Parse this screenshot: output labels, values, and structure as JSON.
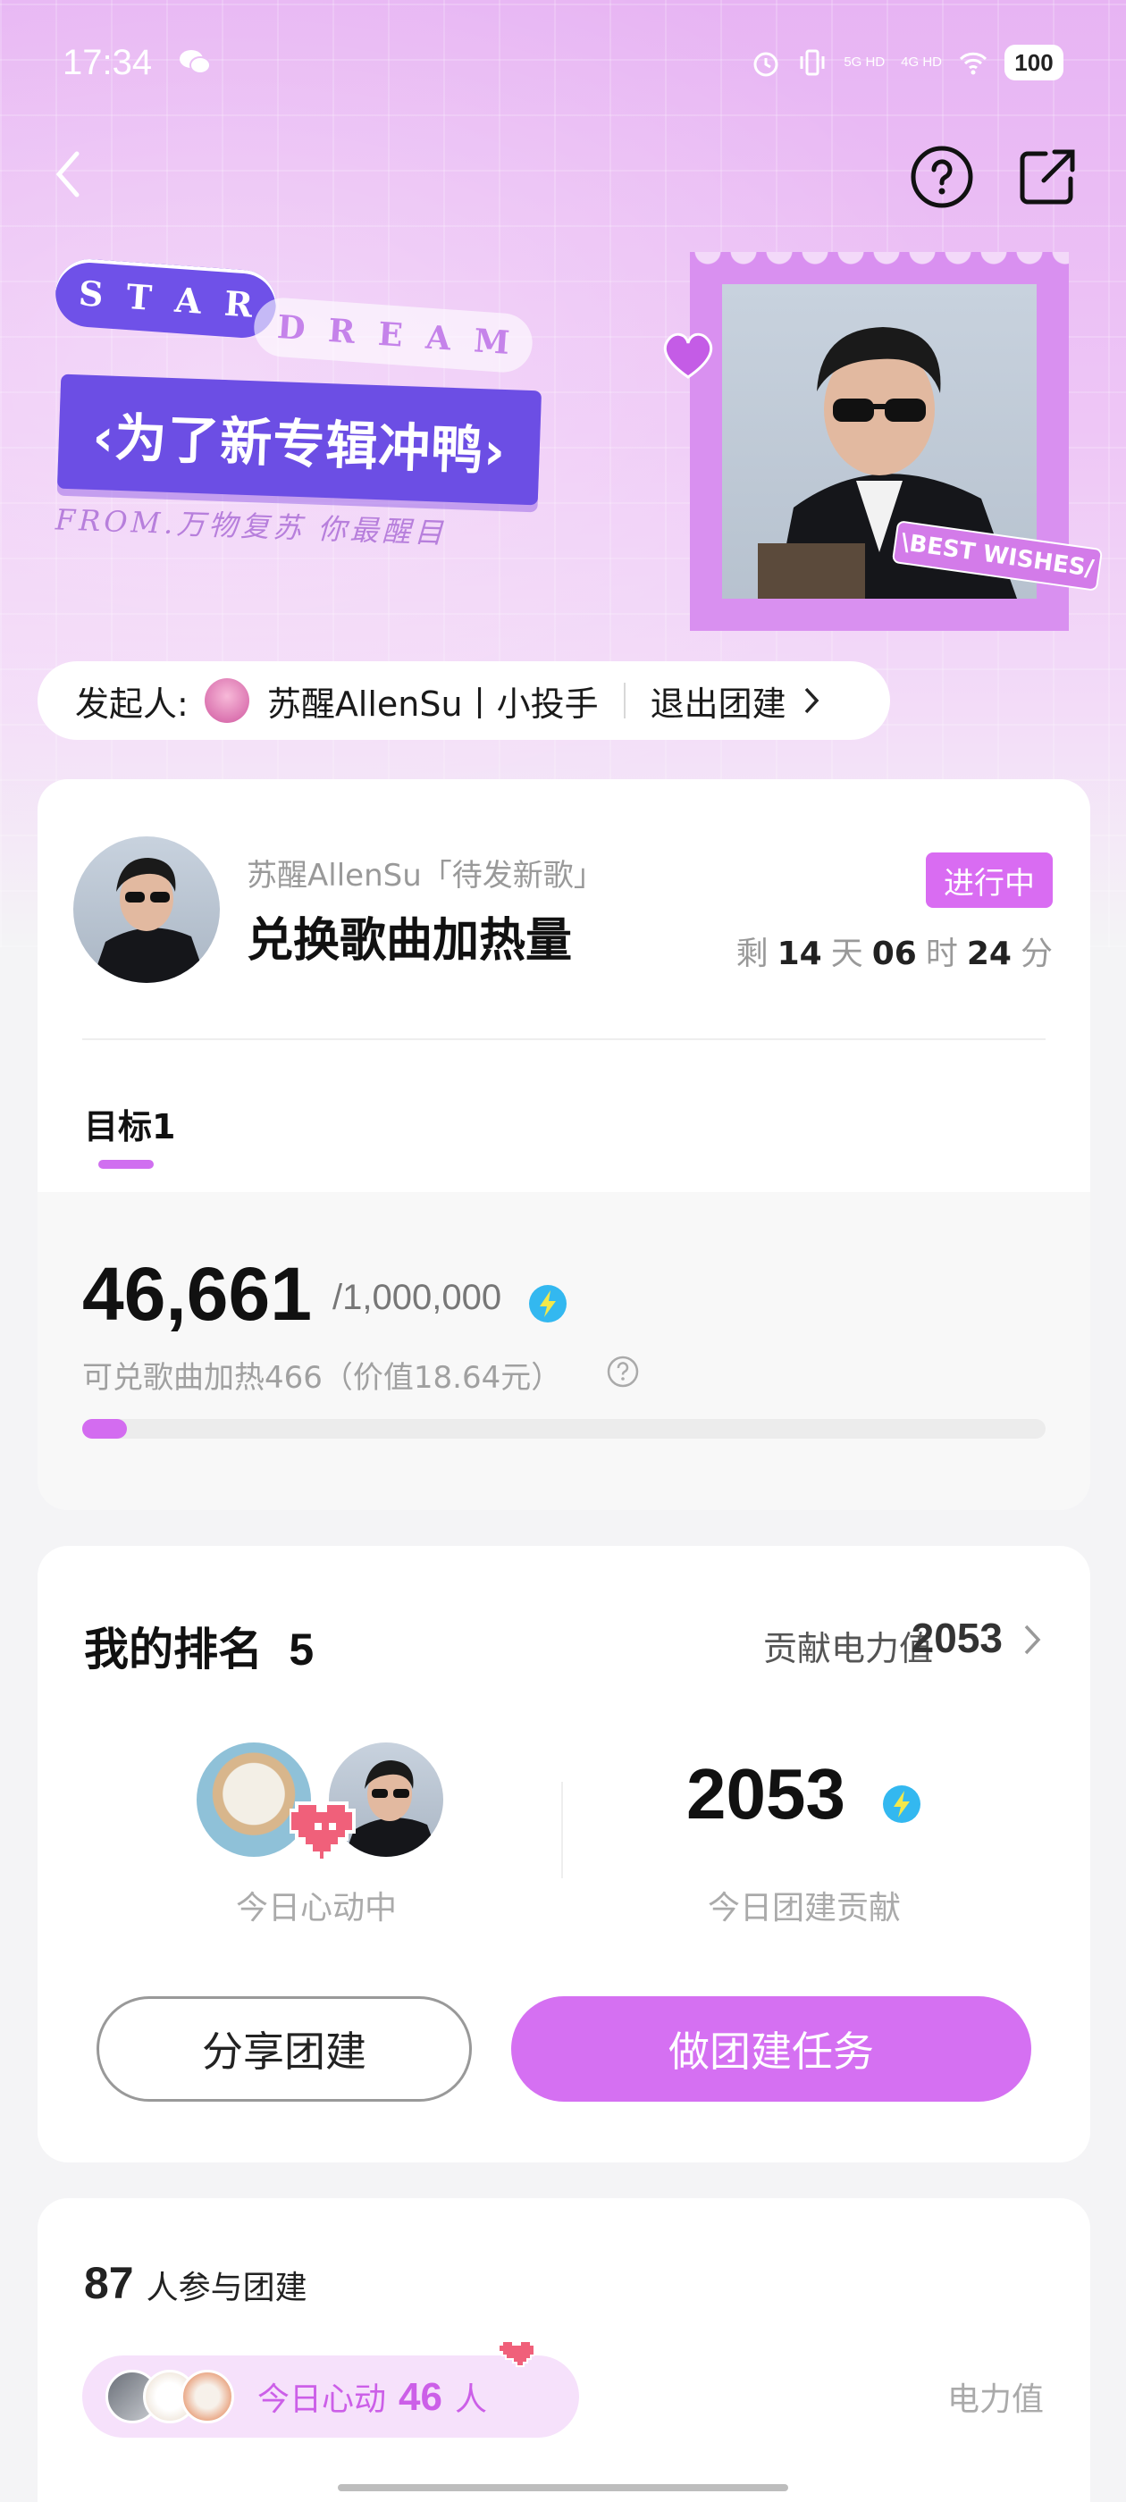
{
  "status_bar": {
    "time": "17:34",
    "net1": "5G HD",
    "net2": "4G HD",
    "battery": "100"
  },
  "banner": {
    "star_letters": [
      "S",
      "T",
      "A",
      "R"
    ],
    "dream_letters": [
      "D",
      "R",
      "E",
      "A",
      "M"
    ],
    "title": "‹为了新专辑冲鸭›",
    "from": "FROM.万物复苏 你最醒目",
    "best_wishes": "\\BEST WISHES/"
  },
  "initiator": {
    "label": "发起人:",
    "name": "苏醒AllenSu丨小投手",
    "exit_label": "退出团建"
  },
  "campaign": {
    "artist_line": "苏醒AllenSu「待发新歌」",
    "title": "兑换歌曲加热量",
    "status": "进行中",
    "countdown": {
      "prefix": "剩",
      "days": "14",
      "days_unit": "天",
      "hours": "06",
      "hours_unit": "时",
      "minutes": "24",
      "minutes_unit": "分"
    },
    "target_tab": "目标1",
    "progress_value": "46,661",
    "progress_goal": "/1,000,000",
    "progress_fraction": 0.046661,
    "description": "可兑歌曲加热466（价值18.64元）"
  },
  "ranking": {
    "title": "我的排名",
    "rank": "5",
    "contrib_label": "贡献电力值",
    "contrib_value": "2053",
    "heart_label": "今日心动中",
    "today_value": "2053",
    "today_label": "今日团建贡献",
    "share_button": "分享团建",
    "task_button": "做团建任务"
  },
  "participants": {
    "count": "87",
    "count_label": "人参与团建",
    "heart_prefix": "今日心动",
    "heart_count": "46",
    "heart_suffix": "人",
    "power_label": "电力值"
  },
  "colors": {
    "accent": "#d570f2",
    "banner_purple": "#6c4ee4",
    "lightning": "#33b8f0"
  }
}
